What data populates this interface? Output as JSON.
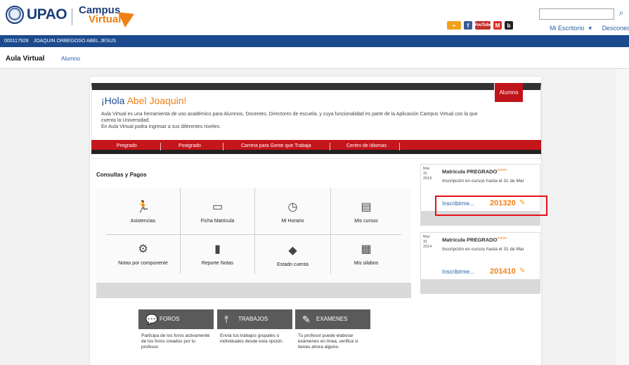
{
  "header": {
    "logo_upao": "UPAO",
    "logo_cv_line1": "Campus",
    "logo_cv_line2": "Virtual",
    "social": [
      {
        "icon": "rss-icon",
        "label": "RSS"
      },
      {
        "icon": "facebook-icon",
        "label": "f"
      },
      {
        "icon": "youtube-icon",
        "label": "YouTube"
      },
      {
        "icon": "gmail-icon",
        "label": "M"
      },
      {
        "icon": "blog-icon",
        "label": "b"
      }
    ],
    "search": {
      "placeholder": "",
      "value": ""
    },
    "links": {
      "escritorio": "Mi Escritorio",
      "desconectar": "Desconectar"
    }
  },
  "userbar": {
    "code": "000117928",
    "name": "JOAQUIN ORBEGOSO ABEL JESUS"
  },
  "aula": {
    "title": "Aula Virtual",
    "tab": "Alumno"
  },
  "welcome": {
    "greeting": "¡Hola",
    "name": "Abel Joaquin!",
    "badge": "Alumno",
    "desc1": "Aula Virtual es una herramienta de uso académico para Alumnos, Docentes, Directores de escuela, y cuya funcionalidad es parte de la Aplicación Campus Virtual con la que cuenta la Universidad.",
    "desc2": "En Aula Virtual podra ingresar a sus diferentes niveles:",
    "menu": [
      "Pregrado",
      "Postgrado",
      "Carrera para Gente que Trabaja",
      "Centro de Idiomas"
    ]
  },
  "consultas": {
    "title": "Consultas y Pagos",
    "items": [
      {
        "label": "Asistencias",
        "icon": "running-person-icon"
      },
      {
        "label": "Ficha Matricula",
        "icon": "folder-icon"
      },
      {
        "label": "Mi Horario",
        "icon": "clock-icon"
      },
      {
        "label": "Mis cursos",
        "icon": "notebook-icon"
      },
      {
        "label": "Notas por componente",
        "icon": "gears-icon"
      },
      {
        "label": "Reporte Notas",
        "icon": "document-icon"
      },
      {
        "label": "Estado cuenta",
        "icon": "tag-icon"
      },
      {
        "label": "Mis silabos",
        "icon": "syllabus-icon"
      }
    ]
  },
  "tools": [
    {
      "label": "FOROS",
      "icon": "chat-bubble-icon",
      "desc": "Participa de los foros activamente de los foros creados por tu profesor."
    },
    {
      "label": "TRABAJOS",
      "icon": "upload-icon",
      "desc": "Envía tus trabajos grupales o individuales desde esta opción."
    },
    {
      "label": "EXAMENES",
      "icon": "edit-icon",
      "desc": "Tu profesor puede elaborar exámenes en línea, verifica si tienes ahora alguno."
    }
  ],
  "matriculas": [
    {
      "date_month": "Mar",
      "date_day": "31",
      "date_year": "2014",
      "title": "Matricula",
      "level": "PREGRADO",
      "new_tag": "nuevo",
      "text": "Inscripción en cursos hasta el 31 de Mar",
      "link": "Inscribirme...",
      "code": "201320"
    },
    {
      "date_month": "Mar",
      "date_day": "31",
      "date_year": "2014",
      "title": "Matricula",
      "level": "PREGRADO",
      "new_tag": "nuevo",
      "text": "Inscripción en cursos hasta el 31 de Mar",
      "link": "Inscribirme...",
      "code": "201410"
    }
  ],
  "colors": {
    "brand_blue": "#1b4a8e",
    "brand_orange": "#f07f14",
    "menu_red": "#c4161c",
    "highlight_red": "#e5101a"
  }
}
